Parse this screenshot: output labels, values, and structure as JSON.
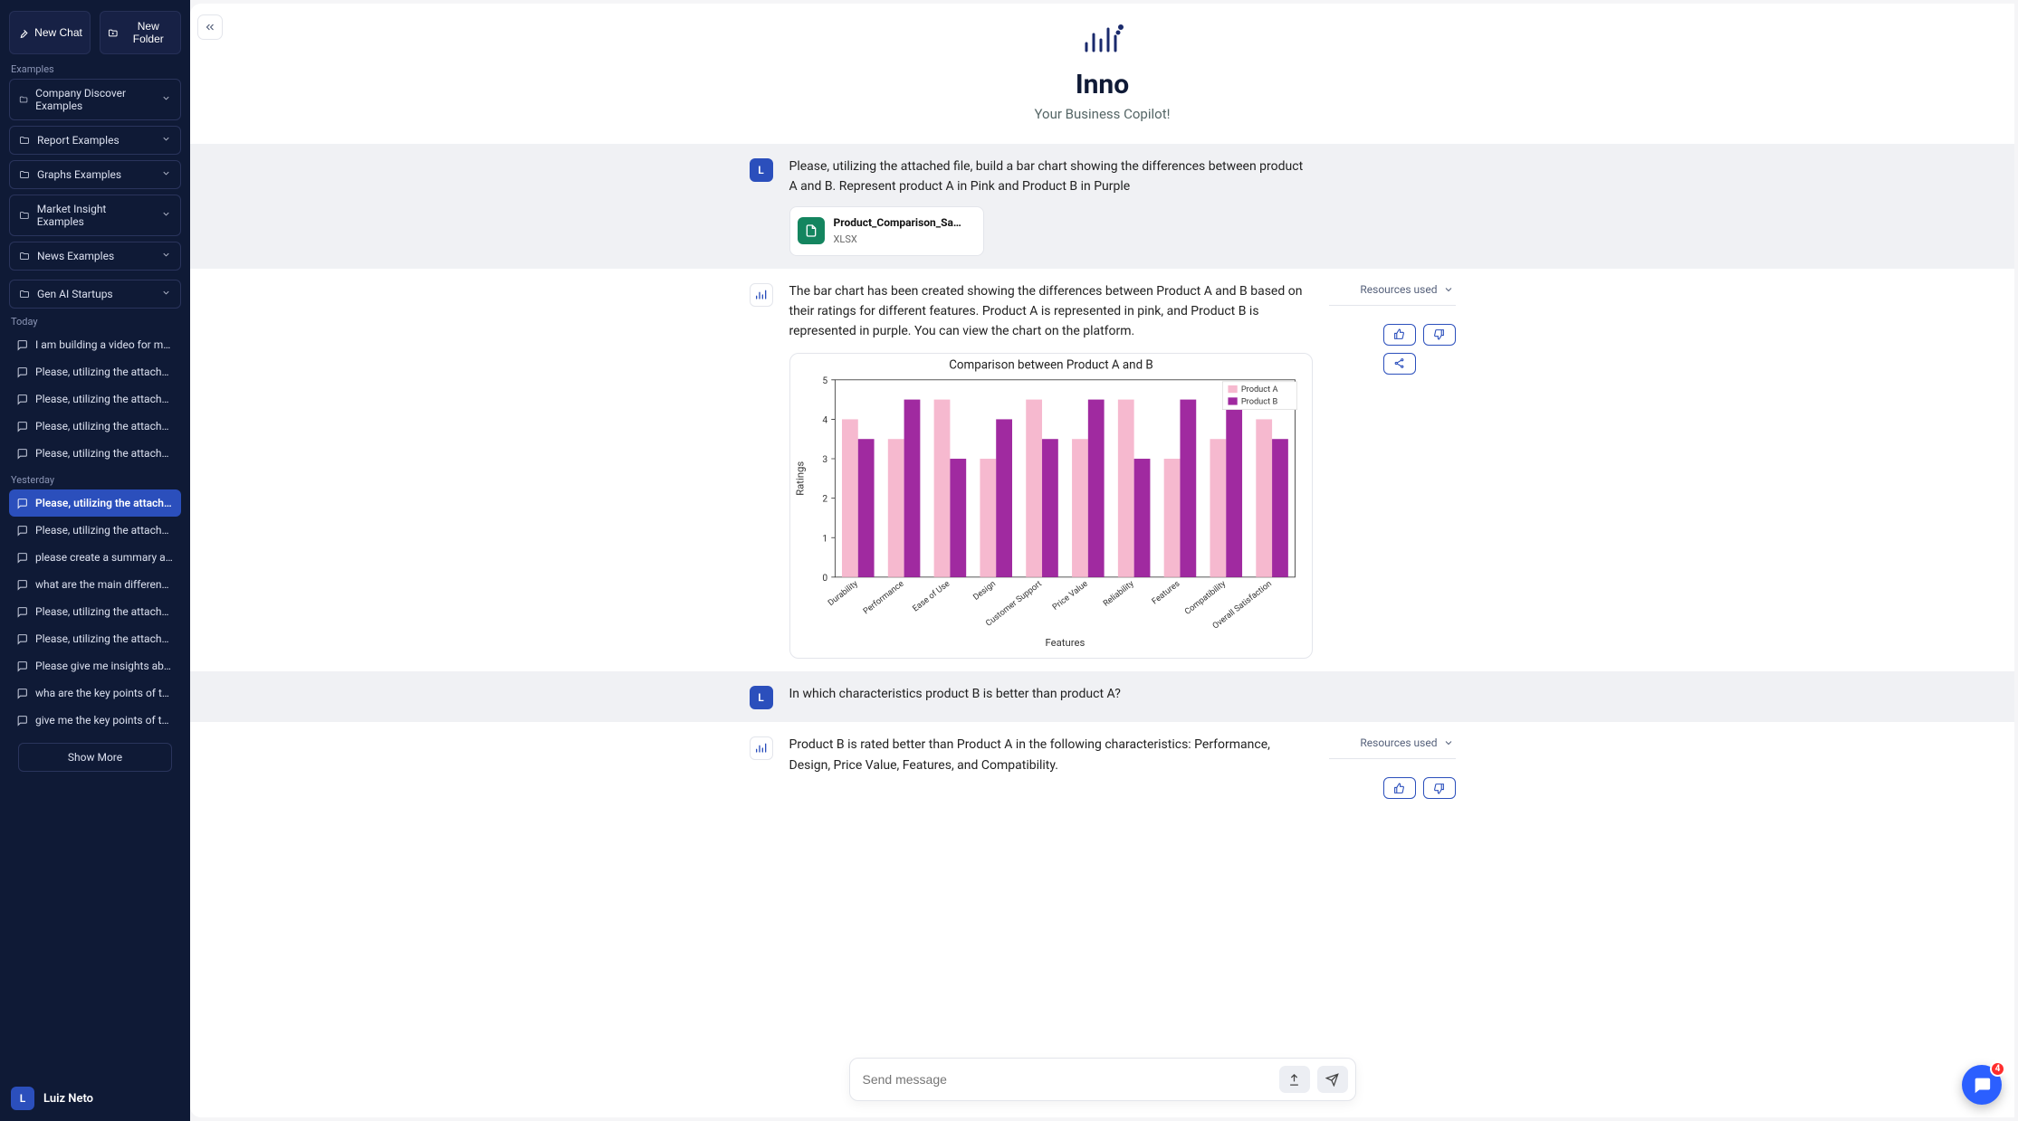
{
  "sidebar": {
    "new_chat": "New Chat",
    "new_folder": "New Folder",
    "examples_label": "Examples",
    "example_folders": [
      "Company Discover Examples",
      "Report Examples",
      "Graphs Examples",
      "Market Insight Examples",
      "News Examples"
    ],
    "custom_folders": [
      "Gen AI Startups"
    ],
    "today_label": "Today",
    "today_items": [
      "I am building a video for my h…",
      "Please, utilizing the attached…",
      "Please, utilizing the attached…",
      "Please, utilizing the attached…",
      "Please, utilizing the attached…"
    ],
    "yesterday_label": "Yesterday",
    "yesterday_items": [
      "Please, utilizing the attached…",
      "Please, utilizing the attached…",
      "please create a summary about …",
      "what are the main differences …",
      "Please, utilizing the attached…",
      "Please, utilizing the attached…",
      "Please give me insights about …",
      "wha are the key points of the …",
      "give me the key points of the …"
    ],
    "active_yesterday_index": 0,
    "show_more": "Show More",
    "user_initial": "L",
    "user_name": "Luiz Neto"
  },
  "hero": {
    "title": "Inno",
    "subtitle": "Your Business Copilot!"
  },
  "messages": {
    "user1": "Please, utilizing the attached file, build a bar chart showing the differences between product A and B. Represent product A in Pink and Product B in Purple",
    "attachment_name": "Product_Comparison_Sa…",
    "attachment_type": "XLSX",
    "assistant1": "The bar chart has been created showing the differences between Product A and B based on their ratings for different features. Product A is represented in pink, and Product B is represented in purple. You can view the chart on the platform.",
    "user2": "In which characteristics product B is better than product A?",
    "assistant2": "Product B is rated better than Product A in the following characteristics: Performance, Design, Price Value, Features, and Compatibility.",
    "resources_used": "Resources used",
    "user_initial": "L"
  },
  "composer": {
    "placeholder": "Send message"
  },
  "intercom_count": "4",
  "chart_data": {
    "type": "bar",
    "title": "Comparison between Product A and B",
    "xlabel": "Features",
    "ylabel": "Ratings",
    "ylim": [
      0,
      5
    ],
    "categories": [
      "Durability",
      "Performance",
      "Ease of Use",
      "Design",
      "Customer Support",
      "Price Value",
      "Reliability",
      "Features",
      "Compatibility",
      "Overall Satisfaction"
    ],
    "series": [
      {
        "name": "Product A",
        "color": "#f6b9cf",
        "values": [
          4.0,
          3.5,
          4.5,
          3.0,
          4.5,
          3.5,
          4.5,
          3.0,
          3.5,
          4.0
        ]
      },
      {
        "name": "Product B",
        "color": "#a02aa0",
        "values": [
          3.5,
          4.5,
          3.0,
          4.0,
          3.5,
          4.5,
          3.0,
          4.5,
          4.5,
          3.5
        ]
      }
    ]
  }
}
